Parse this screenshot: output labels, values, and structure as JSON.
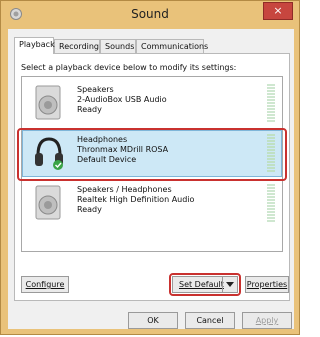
{
  "window": {
    "title": "Sound",
    "close_symbol": "×"
  },
  "tabs": [
    {
      "label": "Playback",
      "active": true
    },
    {
      "label": "Recording",
      "active": false
    },
    {
      "label": "Sounds",
      "active": false
    },
    {
      "label": "Communications",
      "active": false
    }
  ],
  "panel": {
    "instruction": "Select a playback device below to modify its settings:"
  },
  "devices": [
    {
      "name": "Speakers",
      "description": "2-AudioBox USB Audio",
      "status": "Ready",
      "icon": "speaker-icon",
      "selected": false
    },
    {
      "name": "Headphones",
      "description": "Thronmax MDrill ROSA",
      "status": "Default Device",
      "icon": "headphones-icon",
      "selected": true
    },
    {
      "name": "Speakers / Headphones",
      "description": "Realtek High Definition Audio",
      "status": "Ready",
      "icon": "speaker-icon",
      "selected": false
    }
  ],
  "buttons": {
    "configure": "Configure",
    "set_default": "Set Default",
    "properties": "Properties",
    "ok": "OK",
    "cancel": "Cancel",
    "apply": "Apply"
  },
  "colors": {
    "highlight": "#c9312f",
    "selection": "#cde8f6",
    "title_bar": "#e9c27a"
  }
}
